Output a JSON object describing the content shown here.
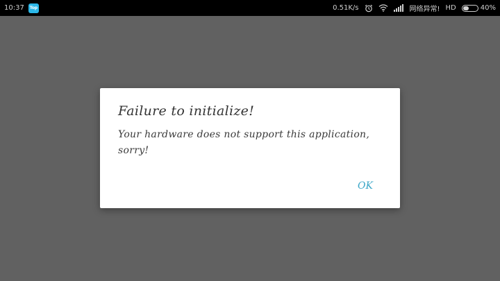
{
  "status_bar": {
    "time": "10:37",
    "app_badge": "Top",
    "net_speed": "0.51K/s",
    "network_message": "网络异常!",
    "hd_label": "HD",
    "battery_percent": "40%",
    "battery_level": 0.4,
    "icons": [
      "alarm-icon",
      "wifi-icon",
      "signal-icon",
      "battery-icon"
    ]
  },
  "dialog": {
    "title": "Failure to initialize!",
    "message": "Your hardware does not support this application, sorry!",
    "ok_label": "OK"
  },
  "colors": {
    "overlay": "#616161",
    "accent": "#3aa6c7",
    "badge": "#2bb7e8"
  }
}
